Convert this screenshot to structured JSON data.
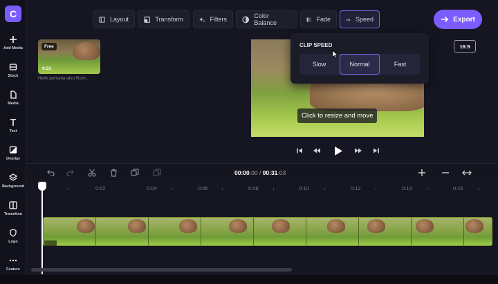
{
  "app": {
    "logo_letter": "C"
  },
  "sidebar": {
    "items": [
      {
        "label": "Add Media",
        "icon": "plus-icon"
      },
      {
        "label": "Stock",
        "icon": "stock-icon"
      },
      {
        "label": "Media",
        "icon": "file-icon"
      },
      {
        "label": "Text",
        "icon": "text-icon"
      },
      {
        "label": "Overlay",
        "icon": "overlay-icon"
      },
      {
        "label": "Background",
        "icon": "layers-icon"
      },
      {
        "label": "Transition",
        "icon": "transition-icon"
      },
      {
        "label": "Logo",
        "icon": "shield-icon"
      },
      {
        "label": "Feature",
        "icon": "more-icon"
      }
    ]
  },
  "toolbar": {
    "tools": [
      "Layout",
      "Transform",
      "Filters",
      "Color Balance",
      "Fade",
      "Speed"
    ],
    "active": "Speed",
    "export_label": "Export"
  },
  "media": {
    "badge": "Free",
    "duration": "0:31",
    "name": "Helix pomatia also Rom..."
  },
  "preview": {
    "aspect_ratio": "16:9",
    "tooltip": "Click to resize and move"
  },
  "speed_menu": {
    "title": "CLIP SPEED",
    "options": [
      "Slow",
      "Normal",
      "Fast"
    ],
    "selected": "Normal"
  },
  "timeline": {
    "current_time_main": "00:00",
    "current_time_frac": ".00",
    "separator": " / ",
    "total_time_main": "00:31",
    "total_time_frac": ".03",
    "ticks": [
      "0:02",
      "0:04",
      "0:06",
      "0:08",
      "0:10",
      "0:12",
      "0:14",
      "0:16"
    ]
  },
  "colors": {
    "accent": "#7b5cff",
    "selected_border": "#7a66e8"
  }
}
